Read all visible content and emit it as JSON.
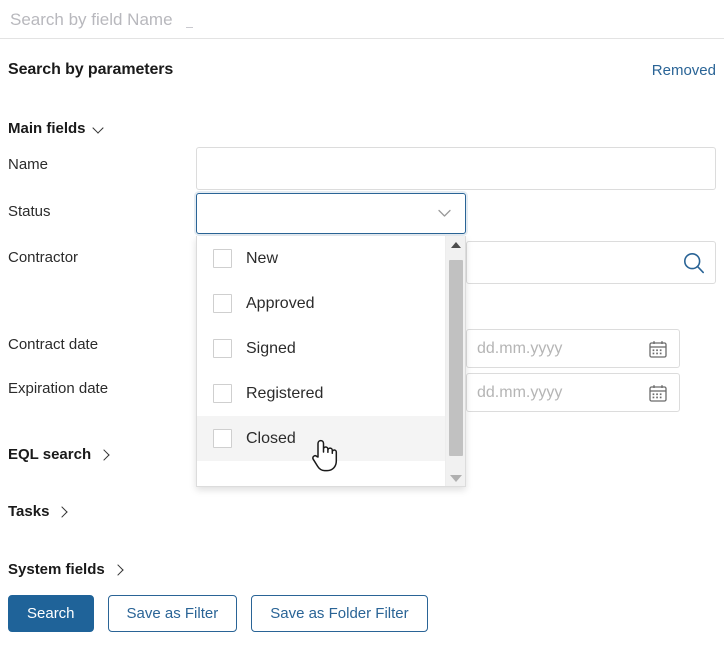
{
  "topbar": {
    "search_placeholder": "Search by field Name",
    "search_value": ""
  },
  "panel": {
    "title": "Search by parameters",
    "removed_label": "Removed"
  },
  "main_fields": {
    "group_label": "Main fields",
    "chevron_icon": "chevron-down-icon",
    "rows": {
      "name": {
        "label": "Name",
        "value": "",
        "placeholder": ""
      },
      "status": {
        "label": "Status",
        "value": "",
        "chevron_icon": "chevron-down-icon"
      },
      "contractor": {
        "label": "Contractor",
        "value": "",
        "placeholder": "",
        "icon": "search-icon"
      },
      "contract_date": {
        "label": "Contract date",
        "value": "",
        "placeholder": "dd.mm.yyyy",
        "icon": "calendar-icon"
      },
      "expiration_date": {
        "label": "Expiration date",
        "value": "",
        "placeholder": "dd.mm.yyyy",
        "icon": "calendar-icon"
      }
    }
  },
  "status_dropdown": {
    "open": true,
    "options": [
      {
        "label": "New",
        "checked": false,
        "hovered": false
      },
      {
        "label": "Approved",
        "checked": false,
        "hovered": false
      },
      {
        "label": "Signed",
        "checked": false,
        "hovered": false
      },
      {
        "label": "Registered",
        "checked": false,
        "hovered": false
      },
      {
        "label": "Closed",
        "checked": false,
        "hovered": true
      }
    ],
    "scrollbar": {
      "up_icon": "triangle-up-icon",
      "down_icon": "triangle-down-icon"
    }
  },
  "sections": [
    {
      "label": "EQL search",
      "chevron_icon": "chevron-right-icon"
    },
    {
      "label": "Tasks",
      "chevron_icon": "chevron-right-icon"
    },
    {
      "label": "System fields",
      "chevron_icon": "chevron-right-icon"
    }
  ],
  "buttons": {
    "search": "Search",
    "save_as_filter": "Save as Filter",
    "save_as_folder_filter": "Save as Folder Filter"
  },
  "cursor": {
    "type": "pointer-hand-cursor"
  },
  "colors": {
    "accent_blue": "#2a6496",
    "primary_button": "#1f6399",
    "placeholder_gray": "#b5b5b5",
    "border_gray": "#dcdcdc",
    "hover_row": "#f4f4f4",
    "scrollbar_thumb": "#c1c1c1",
    "scrollbar_track": "#f1f1f1"
  }
}
